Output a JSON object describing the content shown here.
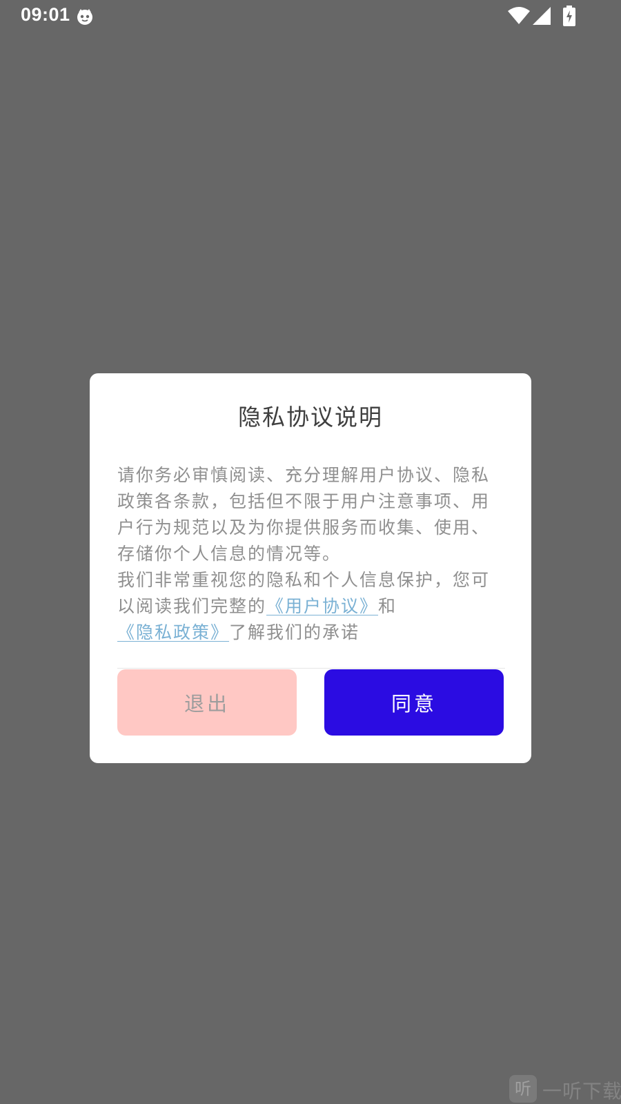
{
  "status_bar": {
    "time": "09:01",
    "app_icon": "cat-face-icon",
    "wifi_icon": "wifi-icon",
    "signal_icon": "cell-signal-icon",
    "battery_icon": "battery-charging-icon"
  },
  "dialog": {
    "title": "隐私协议说明",
    "paragraph1": "请你务必审慎阅读、充分理解用户协议、隐私政策各条款，包括但不限于用户注意事项、用户行为规范以及为你提供服务而收集、使用、存储你个人信息的情况等。",
    "paragraph2_prefix": "我们非常重视您的隐私和个人信息保护，您可以阅读我们完整的",
    "user_agreement_link": "《用户协议》",
    "paragraph2_and": "和",
    "privacy_policy_link": "《隐私政策》",
    "paragraph2_suffix": "了解我们的承诺",
    "exit_button": "退出",
    "agree_button": "同意"
  },
  "watermark": {
    "icon_glyph": "听",
    "text": "一听下载"
  },
  "colors": {
    "backdrop": "#676767",
    "dialog_bg": "#ffffff",
    "title": "#3f3f3f",
    "body_text": "#8f8f8f",
    "link": "#7ab1d4",
    "exit_bg": "#ffc8c4",
    "agree_bg": "#2b0ce2"
  }
}
